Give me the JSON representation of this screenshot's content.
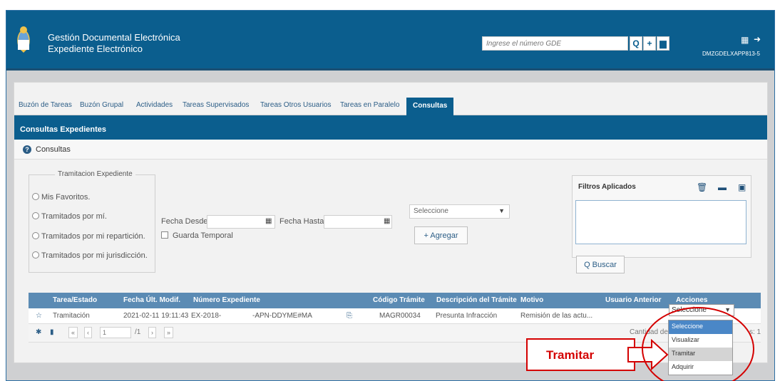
{
  "header": {
    "app_line1": "Gestión Documental Electrónica",
    "app_line2": "Expediente Electrónico",
    "search_placeholder": "Ingrese el número GDE",
    "search_icon": "search-icon",
    "add_icon": "plus-icon",
    "docs_icon": "documents-icon",
    "user_tag": "DMZGDELXAPP813-5"
  },
  "tabs": [
    "Buzón de Tareas",
    "Buzón Grupal",
    "Actividades",
    "Tareas Supervisados",
    "Tareas Otros Usuarios",
    "Tareas en Paralelo",
    "Consultas"
  ],
  "active_tab": "Consultas",
  "section_title": "Consultas Expedientes",
  "consultas_label": "Consultas",
  "tramitacion": {
    "legend": "Tramitacion Expediente",
    "options": [
      "Mis Favoritos.",
      "Tramitados por mí.",
      "Tramitados por mi repartición.",
      "Tramitados por mi jurisdicción."
    ]
  },
  "dates": {
    "desde_label": "Fecha Desde",
    "hasta_label": "Fecha Hasta",
    "guarda_label": "Guarda Temporal"
  },
  "criteria": {
    "select_value": "Seleccione",
    "agregar_label": "+ Agregar"
  },
  "filters": {
    "title": "Filtros Aplicados",
    "buscar_label": "Q Buscar"
  },
  "table": {
    "headers": [
      "Tarea/Estado",
      "Fecha Últ. Modif.",
      "Número Expediente",
      "Código Trámite",
      "Descripción del Trámite",
      "Motivo",
      "Usuario Anterior",
      "Acciones"
    ],
    "row": {
      "tarea": "Tramitación",
      "fecha": "2021-02-11 19:11:43",
      "numero_a": "EX-2018-",
      "numero_b": "-APN-DDYME#MA",
      "codigo": "MAGR00034",
      "descripcion": "Presunta Infracción",
      "motivo": "Remisión de las actu...",
      "usuario": ""
    },
    "pager": {
      "page": "1",
      "total": "/1",
      "cantidad": "Cantidad de re",
      "cantidad_tail": "s: 1"
    }
  },
  "dropdown": {
    "value": "Seleccione",
    "options": [
      "Seleccione",
      "Visualizar",
      "Tramitar",
      "Adquirir"
    ],
    "selected": "Seleccione",
    "highlighted": "Tramitar"
  },
  "annotation": {
    "label": "Tramitar",
    "color": "#d40000"
  },
  "colors": {
    "header_blue": "#0b5e8e",
    "table_head": "#5b8bb4",
    "dropdown_selected": "#4a87c7"
  }
}
